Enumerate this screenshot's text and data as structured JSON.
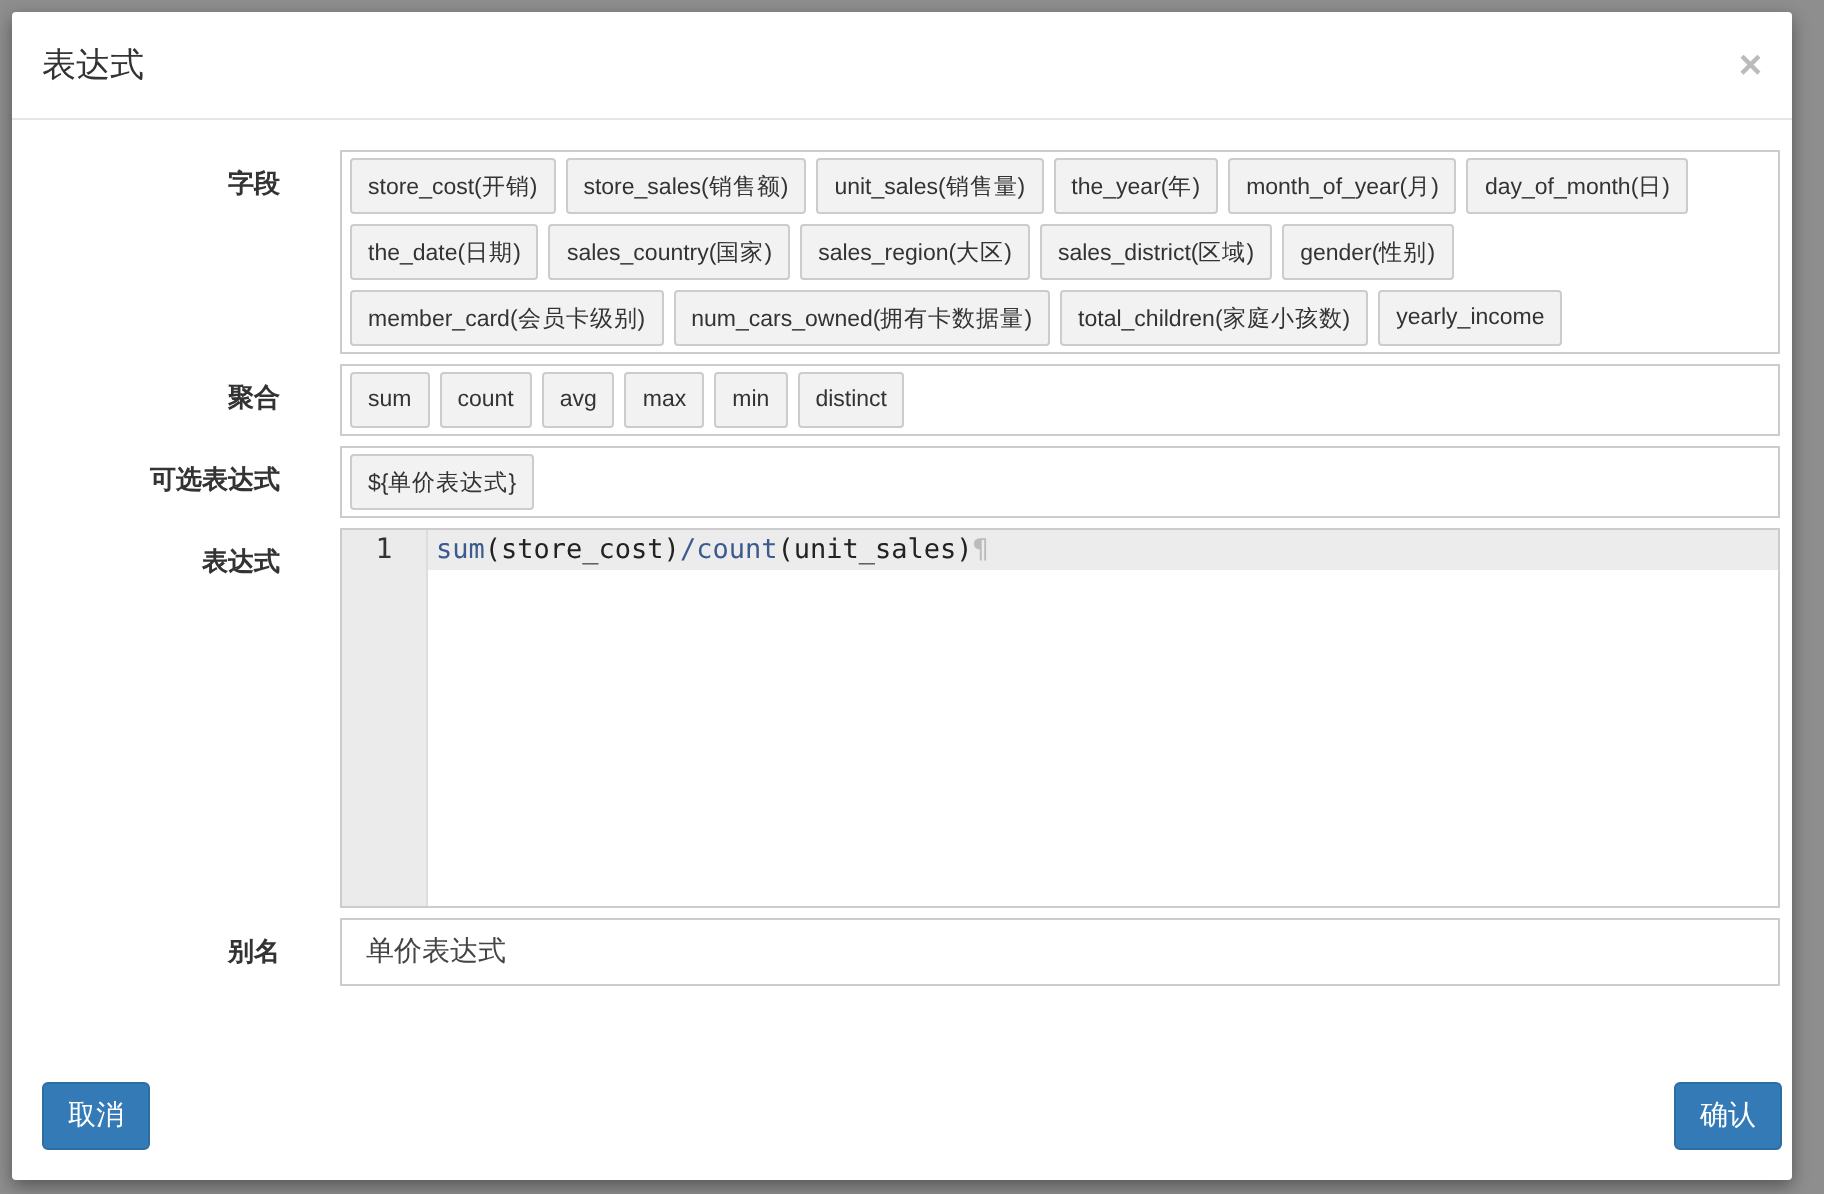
{
  "dialog": {
    "title": "表达式",
    "close": "×",
    "rows": [
      {
        "label": "字段",
        "kind": "chips",
        "chips": [
          "store_cost(开销)",
          "store_sales(销售额)",
          "unit_sales(销售量)",
          "the_year(年)",
          "month_of_year(月)",
          "day_of_month(日)",
          "the_date(日期)",
          "sales_country(国家)",
          "sales_region(大区)",
          "sales_district(区域)",
          "gender(性别)",
          "member_card(会员卡级别)",
          "num_cars_owned(拥有卡数据量)",
          "total_children(家庭小孩数)",
          "yearly_income"
        ]
      },
      {
        "label": "聚合",
        "kind": "chips",
        "chips": [
          "sum",
          "count",
          "avg",
          "max",
          "min",
          "distinct"
        ]
      },
      {
        "label": "可选表达式",
        "kind": "chips",
        "chips": [
          "${单价表达式}"
        ]
      },
      {
        "label": "表达式",
        "kind": "editor",
        "lines": [
          {
            "number": "1",
            "tokens": [
              {
                "kind": "function",
                "text": "sum"
              },
              {
                "kind": "plain",
                "text": "(store_cost)"
              },
              {
                "kind": "operator",
                "text": "/"
              },
              {
                "kind": "function",
                "text": "count"
              },
              {
                "kind": "plain",
                "text": "(unit_sales)"
              },
              {
                "kind": "pilcrow",
                "text": "¶"
              }
            ]
          }
        ]
      },
      {
        "label": "别名",
        "kind": "input",
        "value": "单价表达式"
      }
    ],
    "buttons": [
      "取消",
      "确认"
    ]
  }
}
